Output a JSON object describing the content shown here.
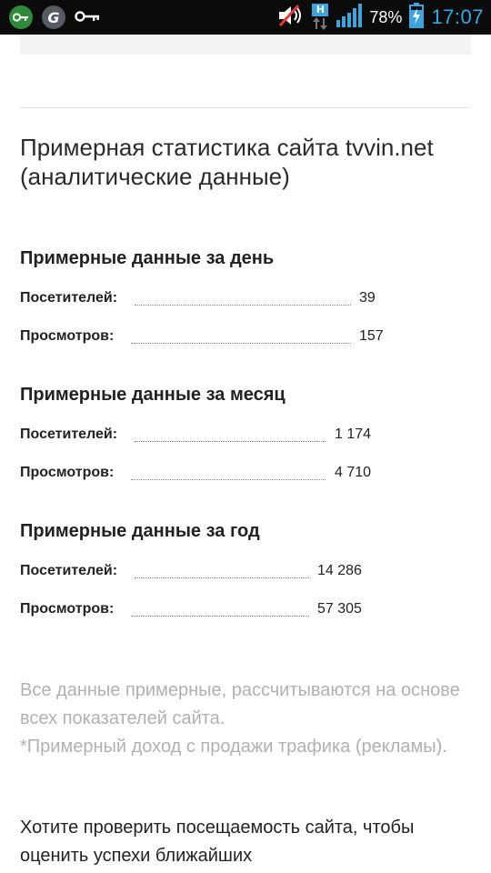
{
  "status_bar": {
    "battery_percent": "78%",
    "time": "17:07",
    "network_badge": "H",
    "icons": [
      "key-app-icon",
      "g-app-icon",
      "key-icon",
      "mute-icon",
      "network-h-icon",
      "signal-icon",
      "battery-charging-icon"
    ]
  },
  "page": {
    "title": "Примерная статистика сайта tvvin.net (аналитические данные)",
    "sections": [
      {
        "heading": "Примерные данные за день",
        "rows": [
          {
            "label": "Посетителей:",
            "value": "39"
          },
          {
            "label": "Просмотров:",
            "value": "157"
          }
        ]
      },
      {
        "heading": "Примерные данные за месяц",
        "rows": [
          {
            "label": "Посетителей:",
            "value": "1 174"
          },
          {
            "label": "Просмотров:",
            "value": "4 710"
          }
        ]
      },
      {
        "heading": "Примерные данные за год",
        "rows": [
          {
            "label": "Посетителей:",
            "value": "14 286"
          },
          {
            "label": "Просмотров:",
            "value": "57 305"
          }
        ]
      }
    ],
    "note_line1": "Все данные примерные, рассчитываются на основе всех показателей сайта.",
    "note_line2": "*Примерный доход с продажи трафика (рекламы).",
    "cta_text": "Хотите проверить посещаемость сайта, чтобы оценить успехи ближайших"
  },
  "colors": {
    "status_bar_bg": "#0b0b0b",
    "clock": "#35a9e6",
    "note_text": "#b1b1b1",
    "notification_green": "#2e8b3a"
  }
}
